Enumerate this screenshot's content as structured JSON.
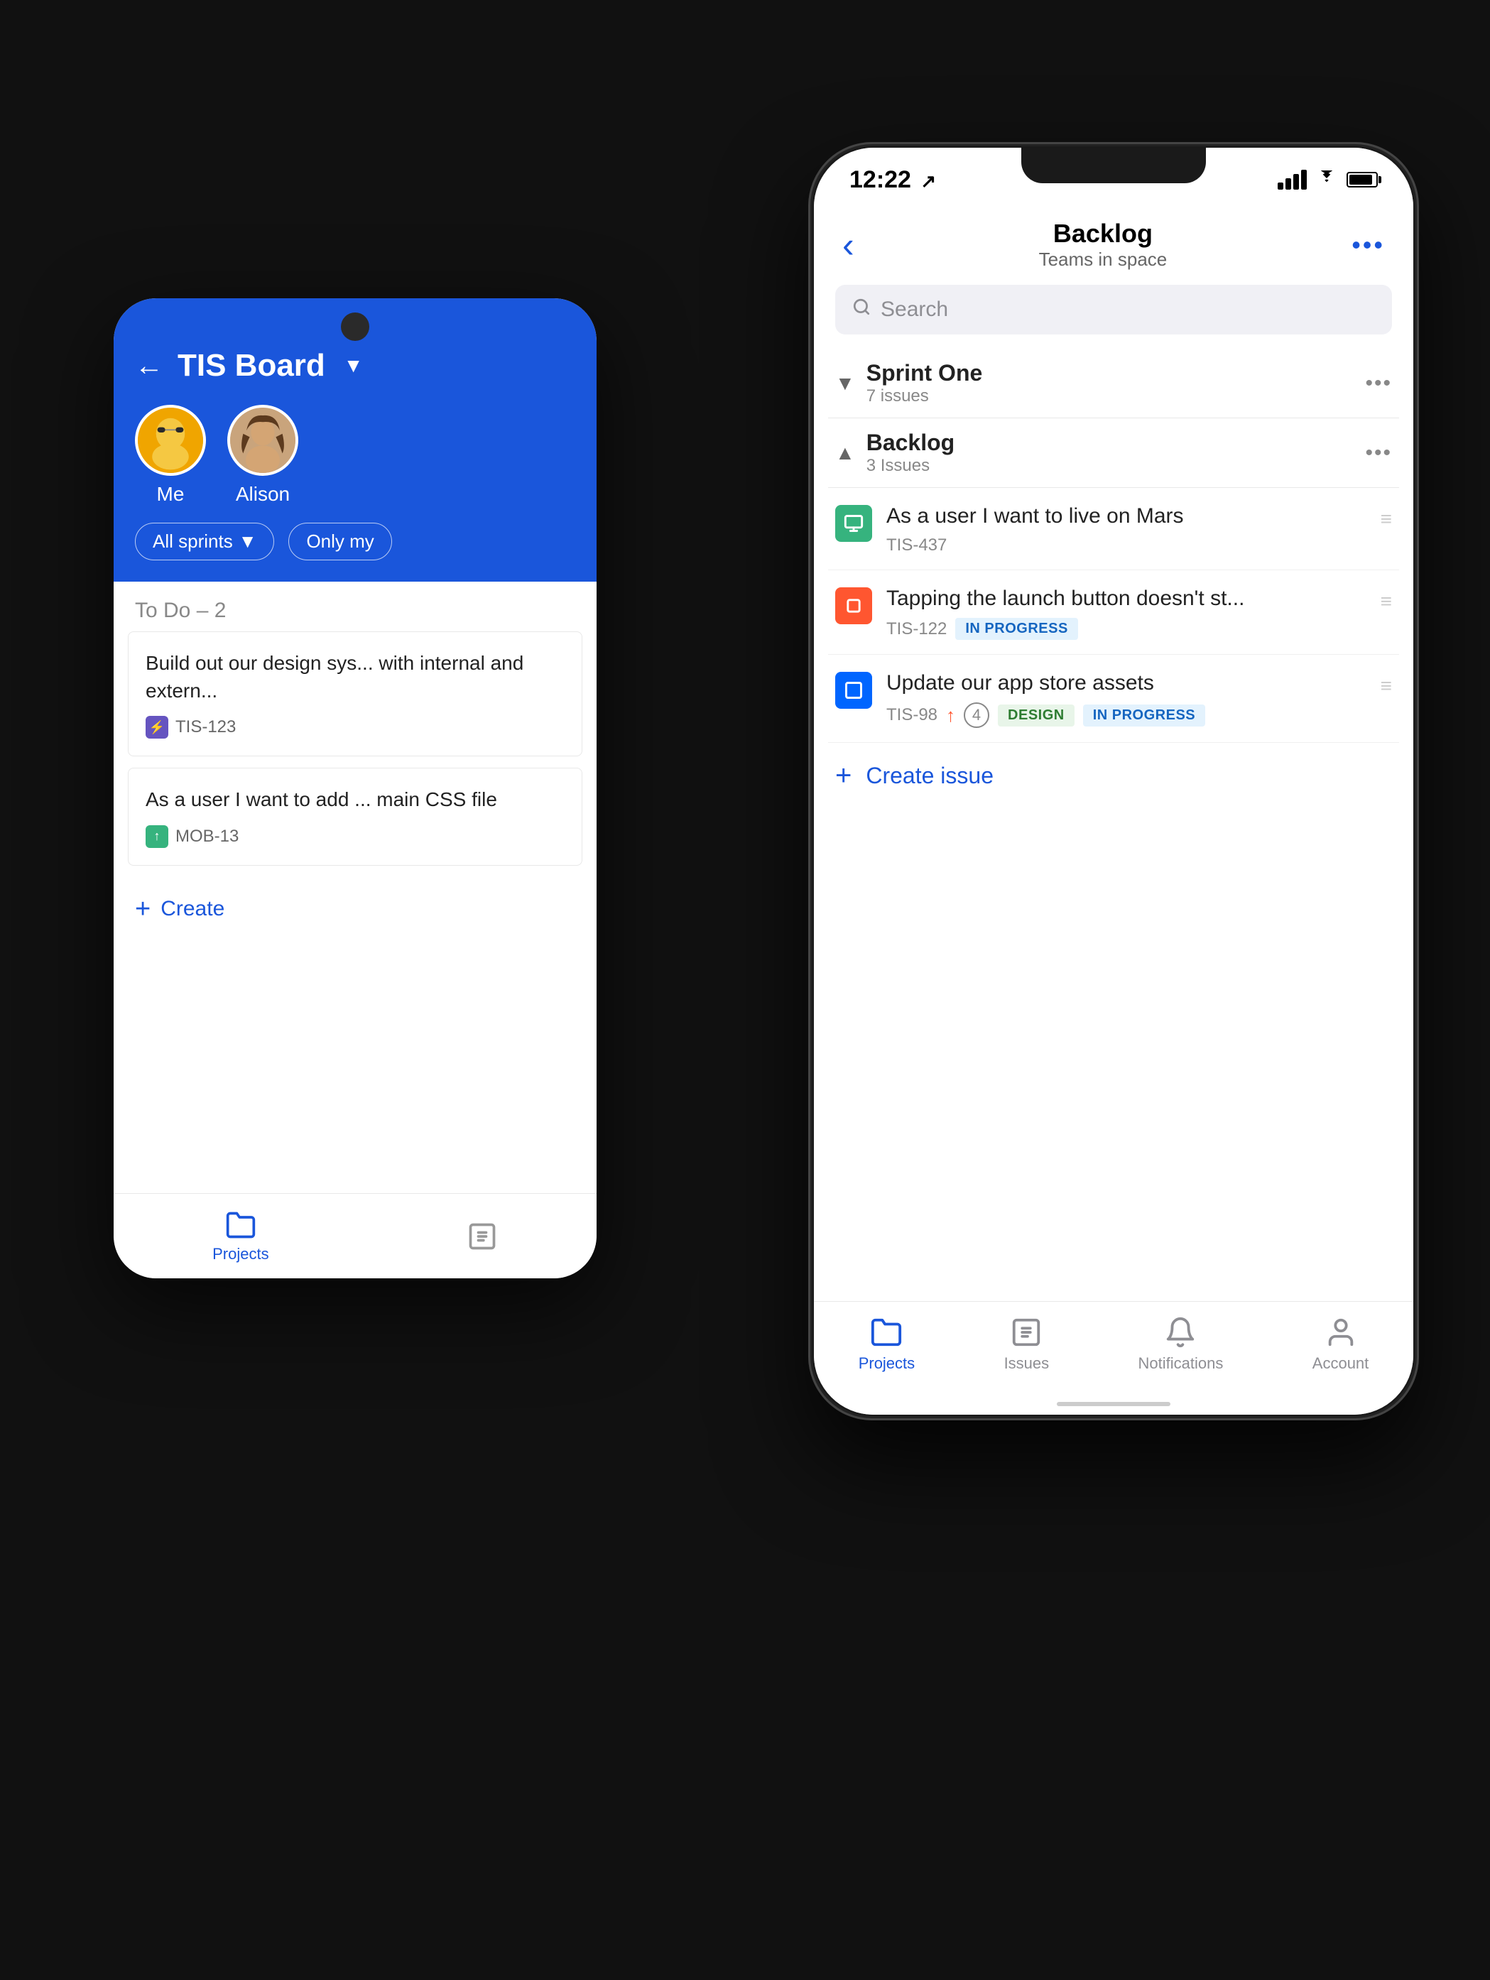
{
  "android": {
    "title": "TIS Board",
    "back_arrow": "←",
    "dropdown_arrow": "▼",
    "avatars": [
      {
        "label": "Me",
        "color": "#f0a500"
      },
      {
        "label": "Alison",
        "color": "#c9a47c"
      }
    ],
    "filters": [
      {
        "label": "All sprints",
        "has_arrow": true
      },
      {
        "label": "Only my"
      }
    ],
    "column_title": "To Do – 2",
    "cards": [
      {
        "text": "Build out our design sys... with internal and extern...",
        "id": "TIS-123",
        "icon_type": "purple",
        "icon_symbol": "⚡"
      },
      {
        "text": "As a user I want to add ... main CSS file",
        "id": "MOB-13",
        "icon_type": "green",
        "icon_symbol": "↑"
      }
    ],
    "create_label": "Create",
    "bottom_nav": [
      {
        "label": "Projects",
        "icon": "📁",
        "active": true
      }
    ]
  },
  "ios": {
    "status_bar": {
      "time": "12:22",
      "time_icon": "↗"
    },
    "header": {
      "back_label": "‹",
      "title": "Backlog",
      "subtitle": "Teams in space",
      "more_dots": "•••"
    },
    "search": {
      "placeholder": "Search",
      "icon": "🔍"
    },
    "sections": [
      {
        "title": "Sprint One",
        "count": "7 issues",
        "expanded": false,
        "chevron": "▼"
      },
      {
        "title": "Backlog",
        "count": "3 Issues",
        "expanded": true,
        "chevron": "▲"
      }
    ],
    "issues": [
      {
        "title": "As a user I want to live on Mars",
        "id": "TIS-437",
        "icon_type": "story",
        "icon_symbol": "▶",
        "badges": [],
        "priority": null,
        "points": null
      },
      {
        "title": "Tapping the launch button doesn't st...",
        "id": "TIS-122",
        "icon_type": "bug",
        "icon_symbol": "■",
        "badges": [
          "IN PROGRESS"
        ],
        "priority": null,
        "points": null
      },
      {
        "title": "Update our app store assets",
        "id": "TIS-98",
        "icon_type": "task",
        "icon_symbol": "□",
        "badges": [
          "DESIGN",
          "IN PROGRESS"
        ],
        "priority": "high",
        "points": "4"
      }
    ],
    "create_issue_label": "Create issue",
    "bottom_nav": [
      {
        "label": "Projects",
        "icon": "folder",
        "active": true
      },
      {
        "label": "Issues",
        "icon": "checklist",
        "active": false
      },
      {
        "label": "Notifications",
        "icon": "bell",
        "active": false
      },
      {
        "label": "Account",
        "icon": "person",
        "active": false
      }
    ]
  }
}
